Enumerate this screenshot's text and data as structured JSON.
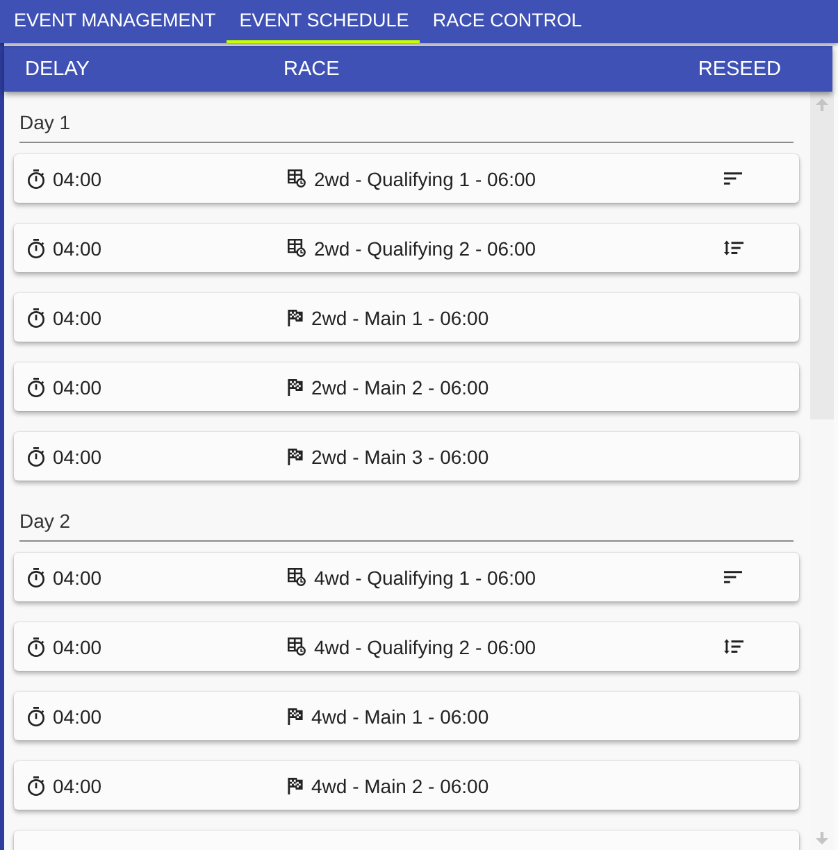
{
  "tabs": [
    {
      "label": "EVENT MANAGEMENT",
      "selected": false
    },
    {
      "label": "EVENT SCHEDULE",
      "selected": true
    },
    {
      "label": "RACE CONTROL",
      "selected": false
    }
  ],
  "columns": [
    "DELAY",
    "RACE",
    "RESEED"
  ],
  "days": [
    {
      "title": "Day 1",
      "more_below": false,
      "races": [
        {
          "delay": "04:00",
          "kind": "qualifying",
          "name": "2wd - Qualifying 1 - 06:00",
          "reseed": true,
          "reseed_swap": false
        },
        {
          "delay": "04:00",
          "kind": "qualifying",
          "name": "2wd - Qualifying 2 - 06:00",
          "reseed": true,
          "reseed_swap": true
        },
        {
          "delay": "04:00",
          "kind": "main",
          "name": "2wd - Main 1 - 06:00",
          "reseed": false
        },
        {
          "delay": "04:00",
          "kind": "main",
          "name": "2wd - Main 2 - 06:00",
          "reseed": false
        },
        {
          "delay": "04:00",
          "kind": "main",
          "name": "2wd - Main 3 - 06:00",
          "reseed": false
        }
      ]
    },
    {
      "title": "Day 2",
      "more_below": true,
      "races": [
        {
          "delay": "04:00",
          "kind": "qualifying",
          "name": "4wd - Qualifying 1 - 06:00",
          "reseed": true,
          "reseed_swap": false
        },
        {
          "delay": "04:00",
          "kind": "qualifying",
          "name": "4wd - Qualifying 2 - 06:00",
          "reseed": true,
          "reseed_swap": true
        },
        {
          "delay": "04:00",
          "kind": "main",
          "name": "4wd - Main 1 - 06:00",
          "reseed": false
        },
        {
          "delay": "04:00",
          "kind": "main",
          "name": "4wd - Main 2 - 06:00",
          "reseed": false
        }
      ]
    }
  ]
}
